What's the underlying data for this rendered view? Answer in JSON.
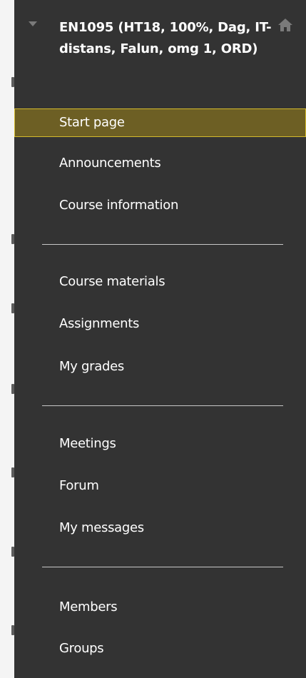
{
  "course": {
    "title": "EN1095 (HT18, 100%, Dag, IT-distans, Falun, omg 1, ORD)",
    "toggle_icon": "chevron-down-icon",
    "home_icon": "home-icon"
  },
  "menu": {
    "group1": [
      {
        "label": "Start page",
        "active": true
      },
      {
        "label": "Announcements"
      },
      {
        "label": "Course information"
      }
    ],
    "group2": [
      {
        "label": "Course materials"
      },
      {
        "label": "Assignments"
      },
      {
        "label": "My grades"
      }
    ],
    "group3": [
      {
        "label": "Meetings"
      },
      {
        "label": "Forum"
      },
      {
        "label": "My messages"
      }
    ],
    "group4": [
      {
        "label": "Members"
      },
      {
        "label": "Groups"
      }
    ]
  },
  "colors": {
    "menu_background": "#333333",
    "active_background": "#6d5f24",
    "active_border": "#d3ba2d",
    "divider": "#c8c8c8",
    "text": "#ffffff"
  }
}
